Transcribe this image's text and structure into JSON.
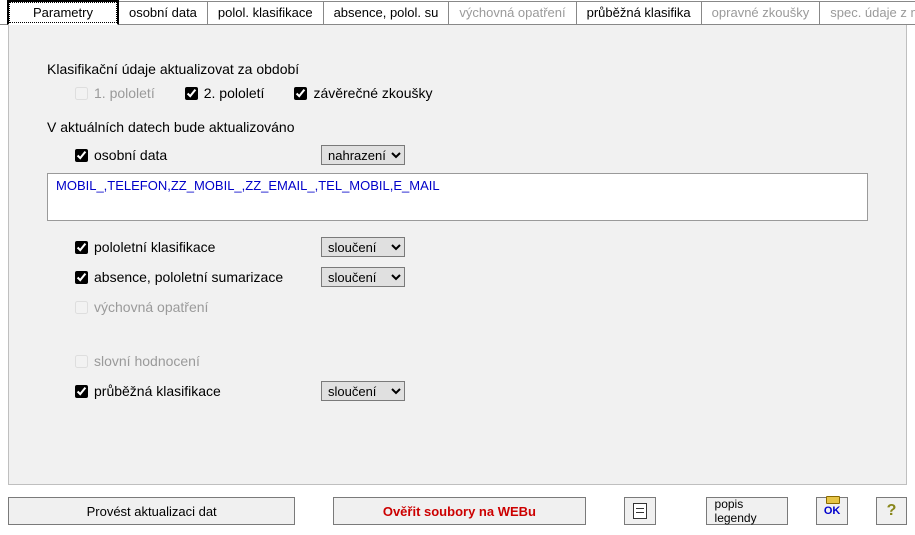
{
  "tabs": [
    {
      "label": "Parametry",
      "state": "active"
    },
    {
      "label": "osobní data",
      "state": "normal"
    },
    {
      "label": "polol. klasifikace",
      "state": "normal"
    },
    {
      "label": "absence, polol. su",
      "state": "normal"
    },
    {
      "label": "výchovná opatření",
      "state": "disabled"
    },
    {
      "label": "průběžná klasifika",
      "state": "normal"
    },
    {
      "label": "opravné zkoušky",
      "state": "disabled"
    },
    {
      "label": "spec. údaje z matri",
      "state": "disabled"
    }
  ],
  "headings": {
    "period": "Klasifikační údaje aktualizovat za období",
    "update": "V aktuálních datech bude aktualizováno"
  },
  "period": {
    "p1": {
      "label": "1. pololetí",
      "checked": false,
      "disabled": true
    },
    "p2": {
      "label": "2. pololetí",
      "checked": true,
      "disabled": false
    },
    "final": {
      "label": "závěrečné zkoušky",
      "checked": true,
      "disabled": false
    }
  },
  "options": {
    "osobni": {
      "label": "osobní data",
      "checked": true,
      "mode": "nahrazení"
    },
    "fields_list": "MOBIL_,TELEFON,ZZ_MOBIL_,ZZ_EMAIL_,TEL_MOBIL,E_MAIL",
    "polol": {
      "label": "pololetní klasifikace",
      "checked": true,
      "mode": "sloučení"
    },
    "absence": {
      "label": "absence, pololetní sumarizace",
      "checked": true,
      "mode": "sloučení"
    },
    "vychovna": {
      "label": "výchovná opatření",
      "checked": false,
      "disabled": true
    },
    "slovni": {
      "label": "slovní hodnocení",
      "checked": false,
      "disabled": true
    },
    "prubezna": {
      "label": "průběžná klasifikace",
      "checked": true,
      "mode": "sloučení"
    }
  },
  "select_options": [
    "nahrazení",
    "sloučení"
  ],
  "toolbar": {
    "perform": "Provést aktualizaci dat",
    "verify": "Ověřit soubory na WEBu",
    "legend": "popis legendy",
    "ok_text": "OK"
  }
}
